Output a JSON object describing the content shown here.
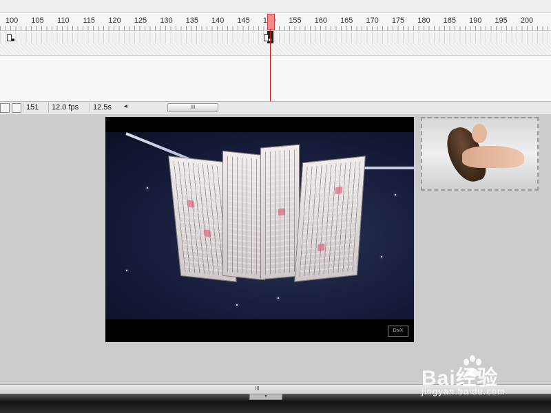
{
  "timeline": {
    "ruler_labels": [
      "100",
      "105",
      "110",
      "115",
      "120",
      "125",
      "130",
      "135",
      "140",
      "145",
      "150",
      "155",
      "160",
      "165",
      "170",
      "175",
      "180",
      "185",
      "190",
      "195",
      "200"
    ],
    "current_frame_marker": "150"
  },
  "status": {
    "frame": "151",
    "fps": "12.0 fps",
    "elapsed": "12.5s",
    "scroll_left": "◂",
    "scroll_grip": "III"
  },
  "stage": {
    "video_badge": "DivX",
    "thumbnail_alt": "Portrait of a woman with long hair"
  },
  "bottom": {
    "grip": "III",
    "tab_grip": "▾"
  },
  "watermark": {
    "brand": "Bai经验",
    "paw": "du",
    "url": "jingyan.baidu.com"
  },
  "colors": {
    "playhead": "#d11111",
    "stage_bg": "#cccccc",
    "night_sky": "#1a2140"
  }
}
